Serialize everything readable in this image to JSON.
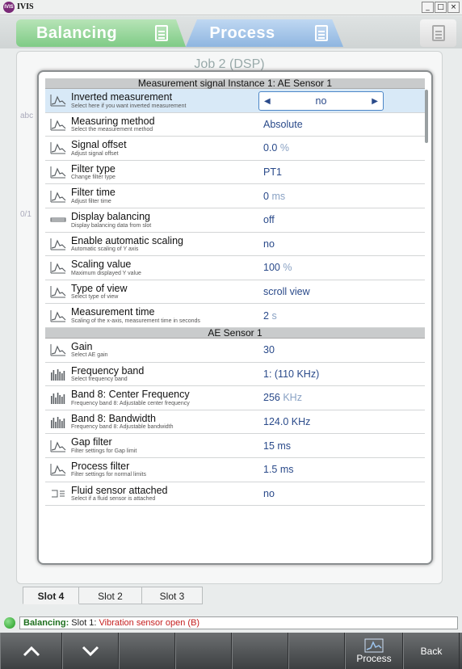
{
  "window": {
    "title": "IVIS",
    "logo_text": "IVIS",
    "controls": [
      "_",
      "□",
      "×"
    ]
  },
  "tabs": {
    "balancing": "Balancing",
    "process": "Process"
  },
  "background": {
    "job_title": "Job 2 (DSP)",
    "side_text_1": "abc",
    "side_text_2": "0/1"
  },
  "dialog": {
    "section1_title": "Measurement signal Instance 1: AE Sensor 1",
    "section2_title": "AE Sensor 1",
    "rows1": [
      {
        "title": "Inverted measurement",
        "sub": "Select here if you want inverted measurement",
        "value": "no",
        "icon": "inverted-measurement-icon",
        "selected": true
      },
      {
        "title": "Measuring method",
        "sub": "Select the measurement method",
        "value": "Absolute",
        "unit": "",
        "icon": "measuring-method-icon"
      },
      {
        "title": "Signal offset",
        "sub": "Adjust signal offset",
        "value": "0.0",
        "unit": "%",
        "icon": "signal-offset-icon"
      },
      {
        "title": "Filter type",
        "sub": "Change filter type",
        "value": "PT1",
        "unit": "",
        "icon": "filter-type-icon"
      },
      {
        "title": "Filter time",
        "sub": "Adjust filter time",
        "value": "0",
        "unit": "ms",
        "icon": "filter-time-icon"
      },
      {
        "title": "Display balancing",
        "sub": "Display balancing data from slot",
        "value": "off",
        "unit": "",
        "icon": "display-balancing-icon"
      },
      {
        "title": "Enable automatic scaling",
        "sub": "Automatic scaling of Y axis",
        "value": "no",
        "unit": "",
        "icon": "auto-scaling-icon"
      },
      {
        "title": "Scaling value",
        "sub": "Maximum displayed Y value",
        "value": "100",
        "unit": "%",
        "icon": "scaling-value-icon"
      },
      {
        "title": "Type of view",
        "sub": "Select type of view",
        "value": "scroll view",
        "unit": "",
        "icon": "type-of-view-icon"
      },
      {
        "title": "Measurement time",
        "sub": "Scaling of the x-axis, measurement time in seconds",
        "value": "2",
        "unit": "s",
        "icon": "measurement-time-icon"
      }
    ],
    "rows2": [
      {
        "title": "Gain",
        "sub": "Select AE gain",
        "value": "30",
        "unit": "",
        "icon": "gain-icon"
      },
      {
        "title": "Frequency band",
        "sub": "Select frequency band",
        "value": "1: (110 KHz)",
        "unit": "",
        "icon": "frequency-band-icon"
      },
      {
        "title": "Band 8: Center Frequency",
        "sub": "Frequency band 8: Adjustable center frequency",
        "value": "256",
        "unit": "KHz",
        "icon": "center-frequency-icon"
      },
      {
        "title": "Band 8: Bandwidth",
        "sub": "Frequency band 8: Adjustable bandwidth",
        "value": "124.0 KHz",
        "unit": "",
        "icon": "bandwidth-icon"
      },
      {
        "title": "Gap filter",
        "sub": "Filter settings for Gap limit",
        "value": "15 ms",
        "unit": "",
        "icon": "gap-filter-icon"
      },
      {
        "title": "Process filter",
        "sub": "Filter settings for normal limits",
        "value": "1.5 ms",
        "unit": "",
        "icon": "process-filter-icon"
      },
      {
        "title": "Fluid sensor attached",
        "sub": "Select if a fluid sensor is attached",
        "value": "no",
        "unit": "",
        "icon": "fluid-sensor-icon"
      }
    ]
  },
  "slot_tabs": [
    "Slot 4",
    "Slot 2",
    "Slot 3"
  ],
  "status": {
    "label": "Balancing:",
    "pre": "Slot 1:",
    "message": "Vibration sensor open (B)"
  },
  "bottom": {
    "up": "^",
    "down": "v",
    "process": "Process",
    "back": "Back"
  },
  "colors": {
    "accent_blue": "#4b86c7",
    "value_text": "#2a4a8a",
    "status_green": "#1f9a1f",
    "status_error": "#c52020"
  }
}
